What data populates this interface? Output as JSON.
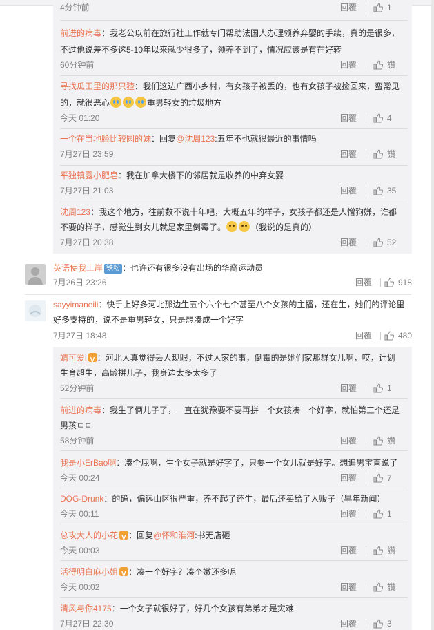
{
  "ui": {
    "reply_label": "回覆",
    "like_label": "讚"
  },
  "top_partial": {
    "time": "4分钟前",
    "reply": "回覆",
    "likes": "1"
  },
  "group1": [
    {
      "name": "前进的病毒",
      "lines": [
        "：我老公以前在旅行社工作就专门帮助法国人办理领养弃婴的手续，真的是很多，",
        "不过他说差不多这5-10年以来就少很多了，领养不到了，情况应该是有在好转"
      ],
      "time": "60分钟前",
      "likes": "讚"
    },
    {
      "name": "寻找瓜田里的那只猹",
      "lines": [
        "：我们这边广西小乡村，有女孩子被丢的，也有女孩子被捡回来，蛮常见",
        "的，就很恶心",
        "重男轻女的垃圾地方"
      ],
      "time": "今天 01:20",
      "likes": "4"
    },
    {
      "name": "一个在当地脸比较圆的妹",
      "reply_prefix": "：回复",
      "mention": "@沈周123",
      "text": ":五年不也就很最近的事情吗",
      "time": "7月27日 23:59",
      "likes": "讚"
    },
    {
      "name": "平独镇露小肥皂",
      "text": "：我在加拿大楼下的邻居就是收养的中弃女婴",
      "time": "7月27日 21:03",
      "likes": "35"
    },
    {
      "name": "沈周123",
      "lines": [
        "：我这个地方，往前数不说十年吧，大概五年的样子，女孩子都还是人憎狗嫌，谁都",
        "不要的样子，感觉生到女儿就是家里倒霉了。",
        "（我说的是真的）"
      ],
      "time": "7月27日 20:38",
      "likes": "52"
    }
  ],
  "comment1": {
    "name": "英语使我上岸",
    "badge": "铁粉",
    "text": "：也许还有很多没有出场的华裔运动员",
    "time": "7月26日 23:26",
    "likes": "918"
  },
  "comment2": {
    "name": "sayyimaneili",
    "lines": [
      "：快手上好多河北那边生五个六个七个甚至八个女孩的主播，还在生，她们的评论里",
      "好多支持的，说不是重男轻女，只是想凑成一个好字"
    ],
    "time": "7月27日 18:48",
    "likes": "480"
  },
  "group2": [
    {
      "name": "婧可爱i",
      "lines": [
        "：河北人真觉得丢人现眼，不过人家的事，倒霉的是她们家那群女儿啊，哎，计划",
        "生育超生，高龄拼儿子，我身边太多太多了"
      ],
      "time": "52分钟前",
      "likes": "1"
    },
    {
      "name": "前进的病毒",
      "lines": [
        "：我生了俩儿子了，一直在犹豫要不要再拼一个女孩凑一个好字，就怕第三个还是",
        "男孩ㄷㄷ"
      ],
      "time": "58分钟前",
      "likes": "讚"
    },
    {
      "name": "我是小ErBao啊",
      "text": "：凑个屁啊，生个女子就是好字了，只要一个女儿就是好字。想追男宝直说了",
      "time": "今天 00:24",
      "likes": "7"
    },
    {
      "name": "DOG-Drunk",
      "text": "：的确，偏远山区很严重，养不起了还生，最后还卖给了人贩子（早年新闻）",
      "time": "今天 00:11",
      "likes": "1"
    },
    {
      "name": "总攻大人的小花",
      "reply_prefix": "：回复",
      "mention": "@怀和淮河",
      "text": ":书无店砸",
      "time": "今天 00:03",
      "likes": "讚"
    },
    {
      "name": "活得明白麻小姐",
      "text": "：凑一个好字？凑个嫩还多呢",
      "time": "今天 00:02",
      "likes": "讚"
    },
    {
      "name": "清风与你4175",
      "text": "：一个女子就很好了，好几个女孩有弟弟才是灾难",
      "time": "7月27日 22:30",
      "likes": "3"
    }
  ]
}
